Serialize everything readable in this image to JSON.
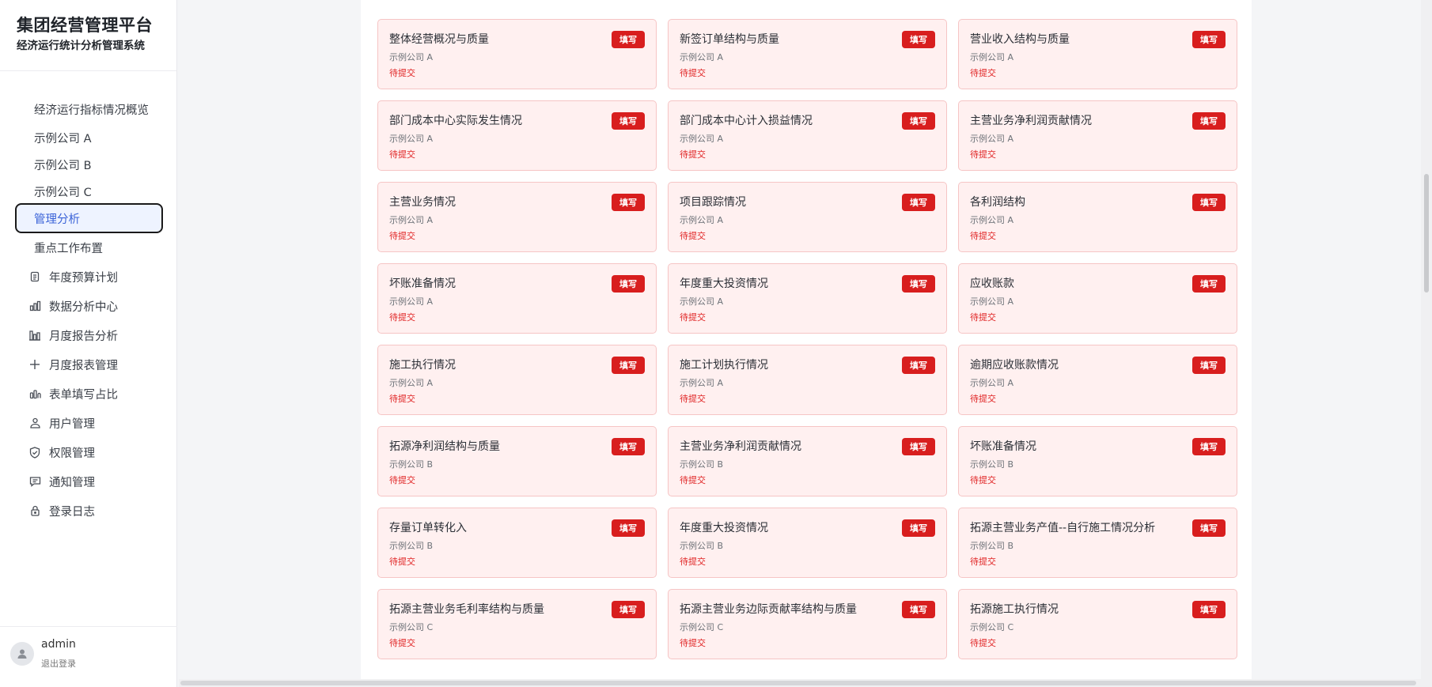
{
  "brand": {
    "title": "集团经营管理平台",
    "subtitle": "经济运行统计分析管理系统"
  },
  "sidebar": {
    "items": [
      {
        "label": "经济运行指标情况概览",
        "icon": ""
      },
      {
        "label": "示例公司 A",
        "icon": ""
      },
      {
        "label": "示例公司 B",
        "icon": ""
      },
      {
        "label": "示例公司 C",
        "icon": ""
      },
      {
        "label": "管理分析",
        "icon": "",
        "active": true
      },
      {
        "label": "重点工作布置",
        "icon": ""
      },
      {
        "label": "年度预算计划",
        "icon": "clipboard-icon"
      },
      {
        "label": "数据分析中心",
        "icon": "bar-chart-icon"
      },
      {
        "label": "月度报告分析",
        "icon": "column-chart-icon"
      },
      {
        "label": "月度报表管理",
        "icon": "plus-icon"
      },
      {
        "label": "表单填写占比",
        "icon": "stats-icon"
      },
      {
        "label": "用户管理",
        "icon": "users-icon"
      },
      {
        "label": "权限管理",
        "icon": "shield-icon"
      },
      {
        "label": "通知管理",
        "icon": "message-icon"
      },
      {
        "label": "登录日志",
        "icon": "lock-icon"
      }
    ]
  },
  "user": {
    "name": "admin",
    "logout_label": "退出登录"
  },
  "cards": [
    {
      "title": "整体经营概况与质量",
      "company": "示例公司 A",
      "status": "待提交",
      "button": "填写"
    },
    {
      "title": "新签订单结构与质量",
      "company": "示例公司 A",
      "status": "待提交",
      "button": "填写"
    },
    {
      "title": "营业收入结构与质量",
      "company": "示例公司 A",
      "status": "待提交",
      "button": "填写"
    },
    {
      "title": "部门成本中心实际发生情况",
      "company": "示例公司 A",
      "status": "待提交",
      "button": "填写"
    },
    {
      "title": "部门成本中心计入损益情况",
      "company": "示例公司 A",
      "status": "待提交",
      "button": "填写"
    },
    {
      "title": "主营业务净利润贡献情况",
      "company": "示例公司 A",
      "status": "待提交",
      "button": "填写"
    },
    {
      "title": "主营业务情况",
      "company": "示例公司 A",
      "status": "待提交",
      "button": "填写"
    },
    {
      "title": "项目跟踪情况",
      "company": "示例公司 A",
      "status": "待提交",
      "button": "填写"
    },
    {
      "title": "各利润结构",
      "company": "示例公司 A",
      "status": "待提交",
      "button": "填写"
    },
    {
      "title": "坏账准备情况",
      "company": "示例公司 A",
      "status": "待提交",
      "button": "填写"
    },
    {
      "title": "年度重大投资情况",
      "company": "示例公司 A",
      "status": "待提交",
      "button": "填写"
    },
    {
      "title": "应收账款",
      "company": "示例公司 A",
      "status": "待提交",
      "button": "填写"
    },
    {
      "title": "施工执行情况",
      "company": "示例公司 A",
      "status": "待提交",
      "button": "填写"
    },
    {
      "title": "施工计划执行情况",
      "company": "示例公司 A",
      "status": "待提交",
      "button": "填写"
    },
    {
      "title": "逾期应收账款情况",
      "company": "示例公司 A",
      "status": "待提交",
      "button": "填写"
    },
    {
      "title": "拓源净利润结构与质量",
      "company": "示例公司 B",
      "status": "待提交",
      "button": "填写"
    },
    {
      "title": "主营业务净利润贡献情况",
      "company": "示例公司 B",
      "status": "待提交",
      "button": "填写"
    },
    {
      "title": "坏账准备情况",
      "company": "示例公司 B",
      "status": "待提交",
      "button": "填写"
    },
    {
      "title": "存量订单转化入",
      "company": "示例公司 B",
      "status": "待提交",
      "button": "填写"
    },
    {
      "title": "年度重大投资情况",
      "company": "示例公司 B",
      "status": "待提交",
      "button": "填写"
    },
    {
      "title": "拓源主营业务产值--自行施工情况分析",
      "company": "示例公司 B",
      "status": "待提交",
      "button": "填写"
    },
    {
      "title": "拓源主营业务毛利率结构与质量",
      "company": "示例公司 C",
      "status": "待提交",
      "button": "填写"
    },
    {
      "title": "拓源主营业务边际贡献率结构与质量",
      "company": "示例公司 C",
      "status": "待提交",
      "button": "填写"
    },
    {
      "title": "拓源施工执行情况",
      "company": "示例公司 C",
      "status": "待提交",
      "button": "填写"
    }
  ],
  "colors": {
    "accent": "#d81e1e",
    "card_bg": "#fff0f0",
    "active_nav_text": "#3b63d8"
  }
}
